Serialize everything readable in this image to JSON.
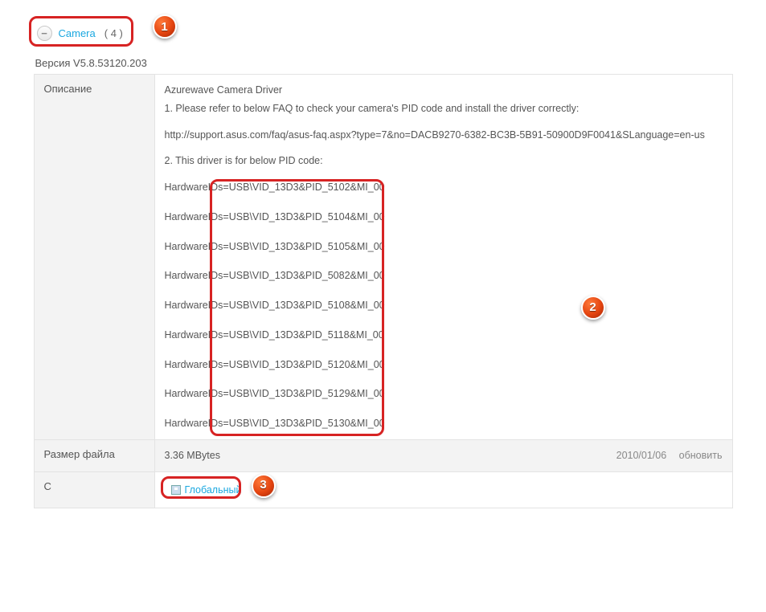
{
  "header": {
    "category": "Camera",
    "count": "( 4 )",
    "minus": "−"
  },
  "version": "Версия V5.8.53120.203",
  "labels": {
    "description": "Описание",
    "filesize": "Размер файла",
    "download": "С"
  },
  "description": {
    "title": "Azurewave Camera Driver",
    "line1": "1. Please refer to below FAQ to check your camera's PID code and install the driver correctly:",
    "url": "http://support.asus.com/faq/asus-faq.aspx?type=7&no=DACB9270-6382-BC3B-5B91-50900D9F0041&SLanguage=en-us",
    "line2": "2. This driver is for below PID code:",
    "hardware_ids": [
      "HardwareIDs=USB\\VID_13D3&PID_5102&MI_00",
      "HardwareIDs=USB\\VID_13D3&PID_5104&MI_00",
      "HardwareIDs=USB\\VID_13D3&PID_5105&MI_00",
      "HardwareIDs=USB\\VID_13D3&PID_5082&MI_00",
      "HardwareIDs=USB\\VID_13D3&PID_5108&MI_00",
      "HardwareIDs=USB\\VID_13D3&PID_5118&MI_00",
      "HardwareIDs=USB\\VID_13D3&PID_5120&MI_00",
      "HardwareIDs=USB\\VID_13D3&PID_5129&MI_00",
      "HardwareIDs=USB\\VID_13D3&PID_5130&MI_00"
    ]
  },
  "filesize": {
    "value": "3.36 MBytes",
    "date": "2010/01/06",
    "update": "обновить"
  },
  "download": {
    "link_text": "Глобальный"
  },
  "badges": {
    "b1": "1",
    "b2": "2",
    "b3": "3"
  }
}
